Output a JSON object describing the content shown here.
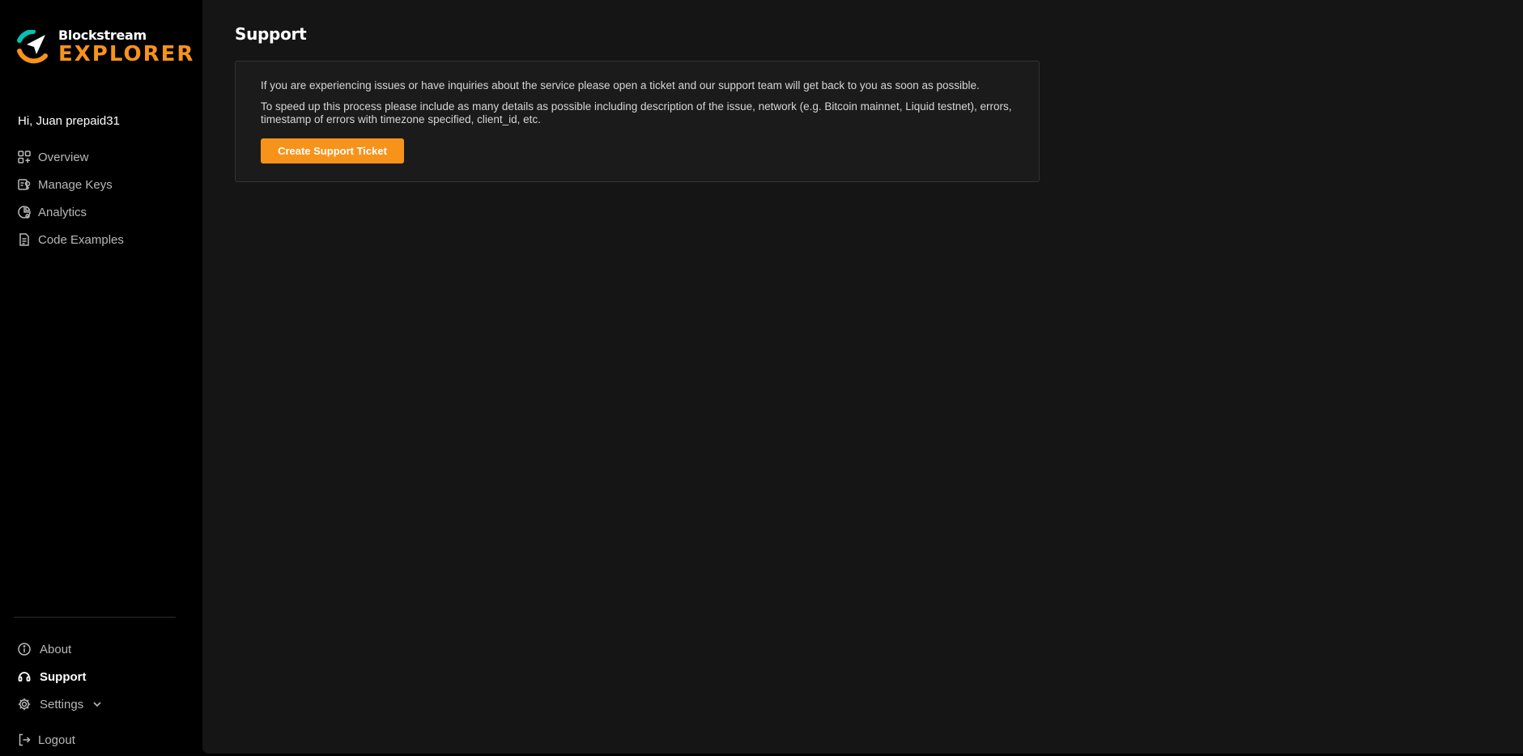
{
  "brand": {
    "top": "Blockstream",
    "bottom": "EXPLORER",
    "accent_color": "#f7931a",
    "logo_icon": "blockstream-logo-icon"
  },
  "sidebar": {
    "greeting": "Hi, Juan prepaid31",
    "main_items": [
      {
        "label": "Overview",
        "icon": "grid-plus-icon"
      },
      {
        "label": "Manage Keys",
        "icon": "key-icon"
      },
      {
        "label": "Analytics",
        "icon": "analytics-icon"
      },
      {
        "label": "Code Examples",
        "icon": "document-icon"
      }
    ],
    "bottom_items": [
      {
        "label": "About",
        "icon": "info-icon"
      },
      {
        "label": "Support",
        "icon": "support-icon",
        "active": true
      },
      {
        "label": "Settings",
        "icon": "gear-icon",
        "expandable": true
      }
    ],
    "logout": {
      "label": "Logout",
      "icon": "logout-icon"
    }
  },
  "main": {
    "title": "Support",
    "card": {
      "paragraph1": "If you are experiencing issues or have inquiries about the service please open a ticket and our support team will get back to you as soon as possible.",
      "paragraph2": "To speed up this process please include as many details as possible including description of the issue, network (e.g. Bitcoin mainnet, Liquid testnet), errors, timestamp of errors with timezone specified, client_id, etc.",
      "button_label": "Create Support Ticket"
    }
  }
}
